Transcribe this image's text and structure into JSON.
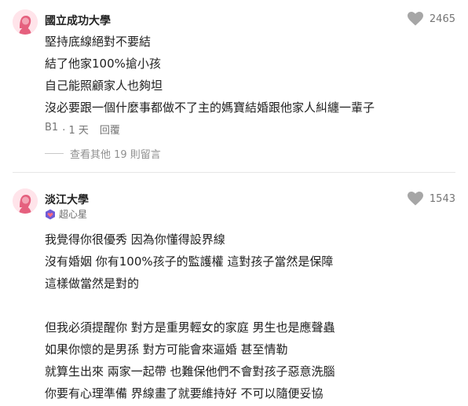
{
  "comments": [
    {
      "author": "國立成功大學",
      "likes": "2465",
      "lines": [
        "堅持底線絕對不要結",
        "結了他家100%搶小孩",
        "自己能照顧家人也夠坦",
        "沒必要跟一個什麼事都做不了主的媽寶結婚跟他家人糾纏一輩子"
      ],
      "floor": "B1",
      "time": "· 1 天",
      "reply_label": "回覆",
      "more_replies": "查看其他 19 則留言"
    },
    {
      "author": "淡江大學",
      "likes": "1543",
      "badge": "超心星",
      "lines": [
        "我覺得你很優秀 因為你懂得設界線",
        "沒有婚姻 你有100%孩子的監護權 這對孩子當然是保障",
        "這樣做當然是對的",
        "",
        "但我必須提醒你 對方是重男輕女的家庭 男生也是應聲蟲",
        "如果你懷的是男孫 對方可能會來逼婚 甚至情勒",
        "就算生出來 兩家一起帶 也難保他們不會對孩子惡意洗腦",
        "你要有心理準備 界線畫了就要維持好 不可以隨便妥協"
      ]
    }
  ]
}
